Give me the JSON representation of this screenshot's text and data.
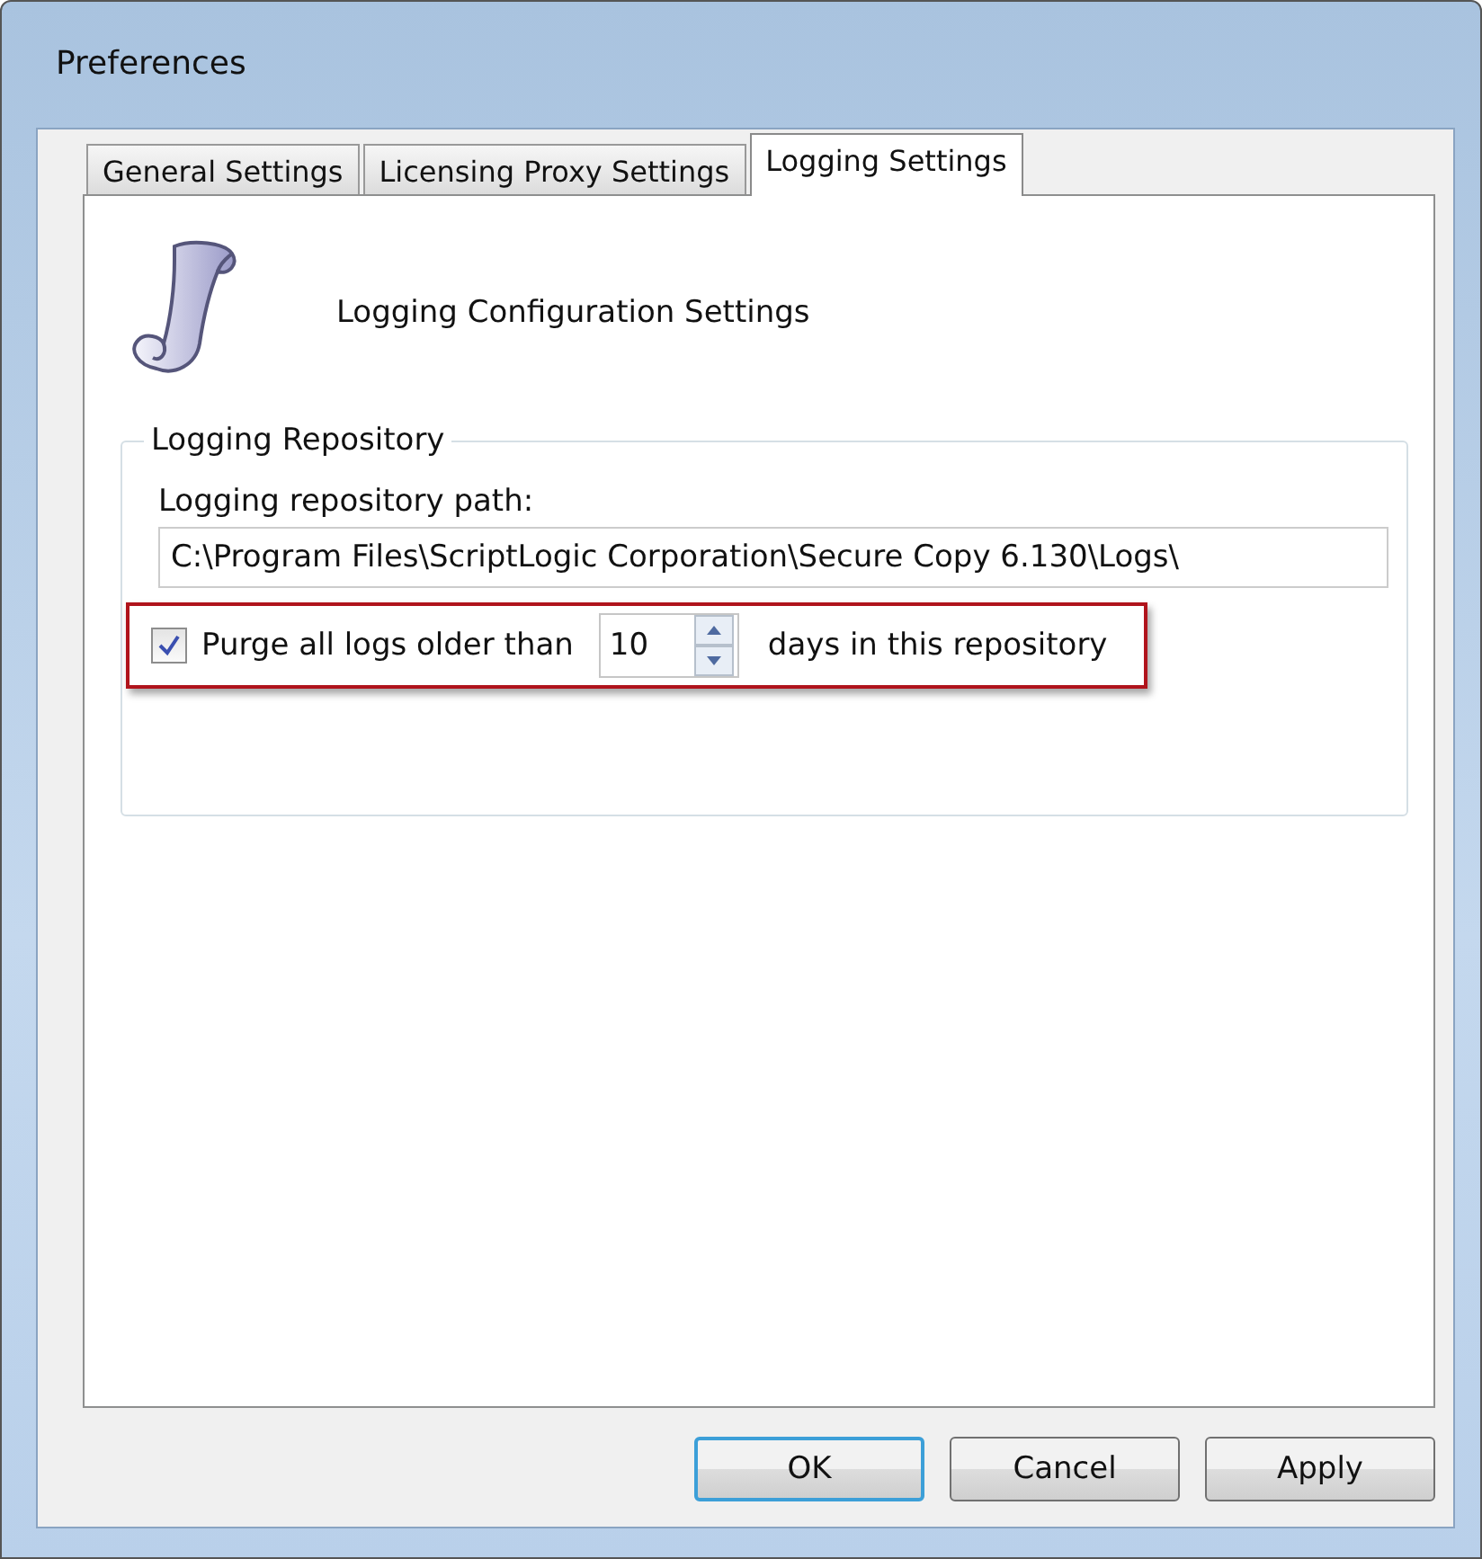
{
  "window": {
    "title": "Preferences"
  },
  "tabs": [
    {
      "label": "General Settings",
      "selected": false
    },
    {
      "label": "Licensing Proxy Settings",
      "selected": false
    },
    {
      "label": "Logging Settings",
      "selected": true
    }
  ],
  "header": {
    "title": "Logging Configuration Settings"
  },
  "group": {
    "title": "Logging Repository",
    "path_label": "Logging repository path:",
    "path_value": "C:\\Program Files\\ScriptLogic Corporation\\Secure Copy 6.130\\Logs\\",
    "purge": {
      "checked": true,
      "label": "Purge all logs older than",
      "value": "10",
      "suffix": "days in this repository",
      "highlighted": true
    }
  },
  "buttons": [
    {
      "label": "OK",
      "default": true
    },
    {
      "label": "Cancel",
      "default": false
    },
    {
      "label": "Apply",
      "default": false
    }
  ]
}
